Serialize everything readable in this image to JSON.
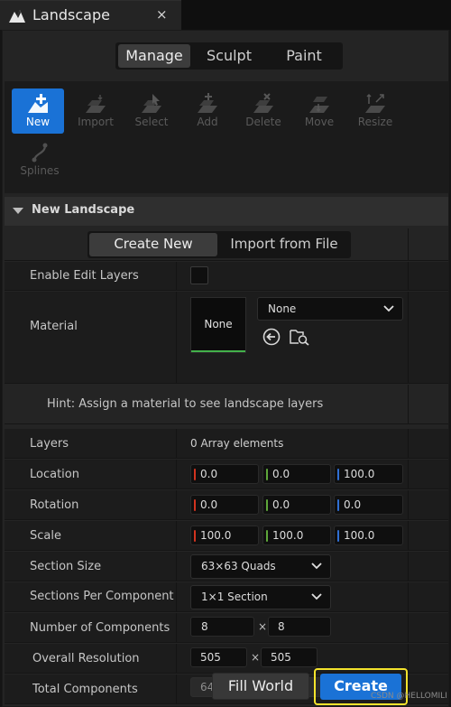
{
  "tab": {
    "title": "Landscape",
    "close": "×"
  },
  "modes": [
    "Manage",
    "Sculpt",
    "Paint"
  ],
  "active_mode": "Manage",
  "tools": [
    {
      "label": "New",
      "icon": "new-landscape-icon",
      "active": true
    },
    {
      "label": "Import",
      "icon": "import-icon"
    },
    {
      "label": "Select",
      "icon": "select-icon"
    },
    {
      "label": "Add",
      "icon": "add-component-icon"
    },
    {
      "label": "Delete",
      "icon": "delete-component-icon"
    },
    {
      "label": "Move",
      "icon": "move-icon"
    },
    {
      "label": "Resize",
      "icon": "resize-icon"
    },
    {
      "label": "Splines",
      "icon": "splines-icon"
    }
  ],
  "section": {
    "title": "New Landscape"
  },
  "create_modes": [
    "Create New",
    "Import from File"
  ],
  "props": {
    "enable_edit_layers": "Enable Edit Layers",
    "material": "Material",
    "material_thumb": "None",
    "material_value": "None",
    "hint": "Hint: Assign a material to see landscape layers",
    "layers": "Layers",
    "layers_value": "0 Array elements",
    "location": "Location",
    "location_values": [
      "0.0",
      "0.0",
      "100.0"
    ],
    "rotation": "Rotation",
    "rotation_values": [
      "0.0",
      "0.0",
      "0.0"
    ],
    "scale": "Scale",
    "scale_values": [
      "100.0",
      "100.0",
      "100.0"
    ],
    "section_size": "Section Size",
    "section_size_value": "63×63 Quads",
    "sections_per_component": "Sections Per Component",
    "sections_per_component_value": "1×1 Section",
    "number_of_components": "Number of Components",
    "number_of_components_values": [
      "8",
      "8"
    ],
    "overall_resolution": "Overall Resolution",
    "overall_resolution_values": [
      "505",
      "505"
    ],
    "total_components": "Total Components",
    "total_components_value": "64",
    "times": "×"
  },
  "buttons": {
    "fill_world": "Fill World",
    "create": "Create"
  },
  "watermark": "CSDN @HELLOMILI",
  "colors": {
    "accent": "#1a72d6",
    "x_axis": "#d2331f",
    "y_axis": "#5ea73a",
    "z_axis": "#2f6fd4",
    "highlight": "#f4e32c"
  }
}
